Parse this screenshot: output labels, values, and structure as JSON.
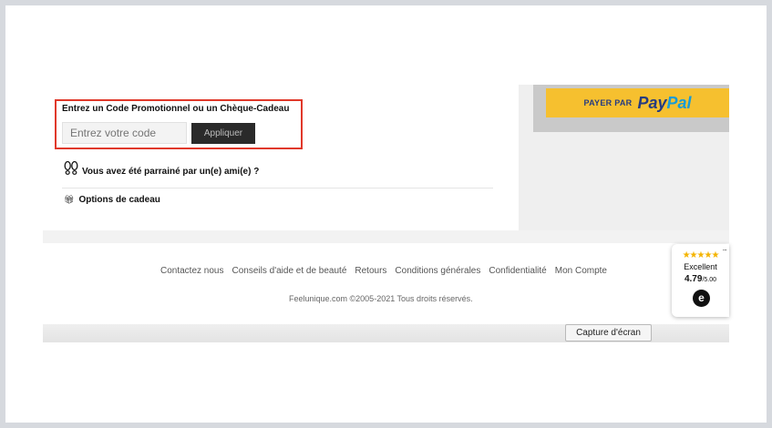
{
  "paypal": {
    "prefix": "PAYER PAR",
    "pay": "Pay",
    "pal": "Pal"
  },
  "promo": {
    "title": "Entrez un Code Promotionnel ou un Chèque-Cadeau",
    "placeholder": "Entrez votre code",
    "value": "",
    "apply_label": "Appliquer"
  },
  "referral": {
    "label": "Vous avez été parrainé par un(e) ami(e) ?"
  },
  "gift": {
    "icon": "gift-icon",
    "label": "Options de cadeau"
  },
  "footer": {
    "links": [
      "Contactez nous",
      "Conseils d'aide et de beauté",
      "Retours",
      "Conditions générales",
      "Confidentialité",
      "Mon Compte"
    ],
    "copyright": "Feelunique.com ©2005-2021 Tous droits réservés."
  },
  "trust_widget": {
    "stars": "★★★★★",
    "label": "Excellent",
    "rating": "4.79",
    "rating_max": "/5.00",
    "logo": "e",
    "menu": "..."
  },
  "screenshot_tool": {
    "label": "Capture d'écran"
  },
  "colors": {
    "paypal_button": "#f6c02f",
    "paypal_dark_blue": "#253b80",
    "paypal_light_blue": "#179bd7",
    "highlight_border": "#e0382a",
    "apply_button": "#2a2a2a",
    "star": "#f4b400"
  }
}
